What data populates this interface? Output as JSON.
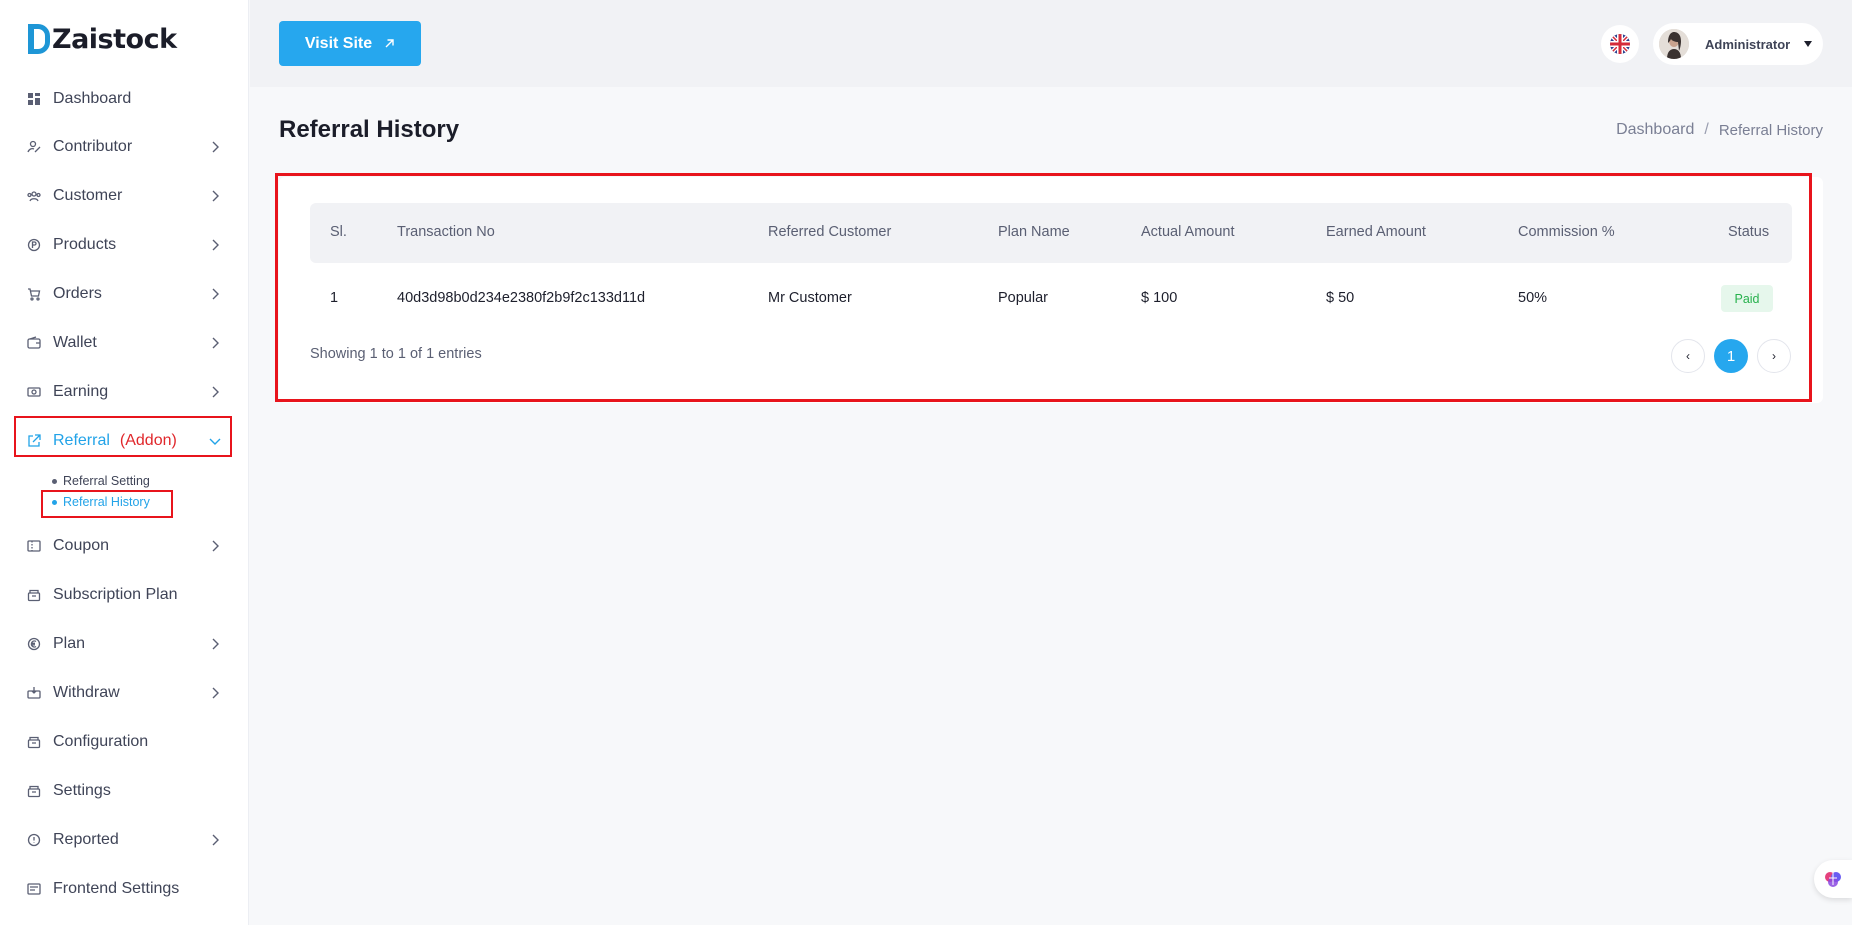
{
  "brand": {
    "name": "Zaistock"
  },
  "sidebar": {
    "items": [
      {
        "label": "Dashboard",
        "icon": "dashboard-icon"
      },
      {
        "label": "Contributor",
        "icon": "contributor-icon"
      },
      {
        "label": "Customer",
        "icon": "customer-icon"
      },
      {
        "label": "Products",
        "icon": "products-icon"
      },
      {
        "label": "Orders",
        "icon": "cart-icon"
      },
      {
        "label": "Wallet",
        "icon": "wallet-icon"
      },
      {
        "label": "Earning",
        "icon": "money-icon"
      },
      {
        "label": "Referral",
        "addon": "(Addon)",
        "icon": "share-icon"
      },
      {
        "label": "Coupon",
        "icon": "coupon-icon"
      },
      {
        "label": "Subscription Plan",
        "icon": "box-icon"
      },
      {
        "label": "Plan",
        "icon": "euro-icon"
      },
      {
        "label": "Withdraw",
        "icon": "withdraw-icon"
      },
      {
        "label": "Configuration",
        "icon": "config-icon"
      },
      {
        "label": "Settings",
        "icon": "settings-icon"
      },
      {
        "label": "Reported",
        "icon": "info-icon"
      },
      {
        "label": "Frontend Settings",
        "icon": "frontend-icon"
      }
    ],
    "sub_items": [
      {
        "label": "Referral Setting"
      },
      {
        "label": "Referral History"
      }
    ]
  },
  "header": {
    "visit_label": "Visit Site",
    "user_name": "Administrator"
  },
  "page": {
    "title": "Referral History",
    "breadcrumb_root": "Dashboard",
    "breadcrumb_sep": "/",
    "breadcrumb_current": "Referral History"
  },
  "table": {
    "columns": [
      "Sl.",
      "Transaction No",
      "Referred Customer",
      "Plan Name",
      "Actual Amount",
      "Earned Amount",
      "Commission %",
      "Status"
    ],
    "rows": [
      {
        "sl": "1",
        "transaction_no": "40d3d98b0d234e2380f2b9f2c133d11d",
        "referred_customer": "Mr Customer",
        "plan_name": "Popular",
        "actual_amount": "$ 100",
        "earned_amount": "$ 50",
        "commission": "50%",
        "status": "Paid"
      }
    ],
    "entries_text": "Showing 1 to 1 of 1 entries"
  },
  "pagination": {
    "prev": "‹",
    "current": "1",
    "next": "›"
  },
  "colors": {
    "accent": "#26a7ee",
    "highlight": "#e8141c",
    "paid_bg": "#e6f7ec",
    "paid_text": "#27b14d"
  }
}
